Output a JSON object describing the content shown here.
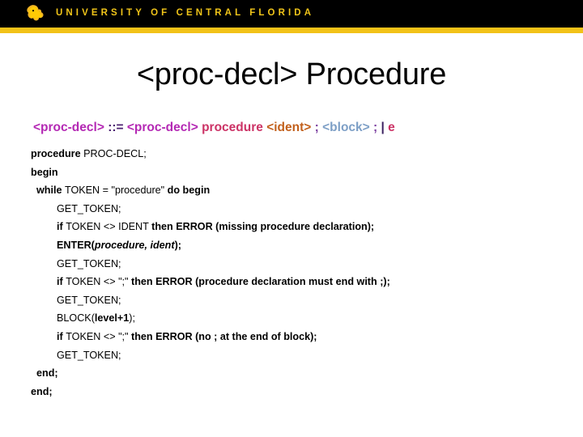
{
  "header": {
    "logo_icon": "ucf-pegasus-icon",
    "wordmark": "UNIVERSITY OF CENTRAL FLORIDA",
    "bar_color": "#000000",
    "rule_color": "#F2C218",
    "wordmark_color": "#F0C419"
  },
  "slide": {
    "title": "<proc-decl> Procedure"
  },
  "grammar": {
    "full_text": "<proc-decl> ::= <proc-decl> procedure <ident> ; <block> ; | e",
    "tokens": [
      {
        "text": "<proc-decl>",
        "role": "nonterminal-proc-decl",
        "color": "#B429B4"
      },
      {
        "text": " ",
        "role": "space",
        "color": "#000000"
      },
      {
        "text": "::=",
        "role": "defines-operator",
        "color": "#4B2070"
      },
      {
        "text": " ",
        "role": "space",
        "color": "#000000"
      },
      {
        "text": "<proc-decl>",
        "role": "nonterminal-proc-decl",
        "color": "#B429B4"
      },
      {
        "text": " ",
        "role": "space",
        "color": "#000000"
      },
      {
        "text": "procedure",
        "role": "terminal-keyword",
        "color": "#CC3366"
      },
      {
        "text": " ",
        "role": "space",
        "color": "#000000"
      },
      {
        "text": "<ident>",
        "role": "nonterminal-ident",
        "color": "#C2601C"
      },
      {
        "text": " ",
        "role": "space",
        "color": "#000000"
      },
      {
        "text": ";",
        "role": "terminal-semicolon",
        "color": "#7B3FA0"
      },
      {
        "text": " ",
        "role": "space",
        "color": "#000000"
      },
      {
        "text": "<block>",
        "role": "nonterminal-block",
        "color": "#7D9FC6"
      },
      {
        "text": " ",
        "role": "space",
        "color": "#000000"
      },
      {
        "text": ";",
        "role": "terminal-semicolon",
        "color": "#7B3FA0"
      },
      {
        "text": " ",
        "role": "space",
        "color": "#000000"
      },
      {
        "text": "|",
        "role": "alternation-bar",
        "color": "#3A2060"
      },
      {
        "text": " ",
        "role": "space",
        "color": "#000000"
      },
      {
        "text": "e",
        "role": "epsilon",
        "color": "#CC3366"
      }
    ]
  },
  "pseudocode": {
    "lines": [
      {
        "indent": 0,
        "runs": [
          {
            "t": "procedure ",
            "s": "b"
          },
          {
            "t": "PROC-DECL;",
            "s": ""
          }
        ]
      },
      {
        "indent": 0,
        "runs": [
          {
            "t": "begin",
            "s": "b"
          }
        ]
      },
      {
        "indent": 1,
        "runs": [
          {
            "t": "while ",
            "s": "b"
          },
          {
            "t": "TOKEN = \"procedure\" ",
            "s": ""
          },
          {
            "t": "do begin",
            "s": "b"
          }
        ]
      },
      {
        "indent": 2,
        "runs": [
          {
            "t": "GET_TOKEN;",
            "s": ""
          }
        ]
      },
      {
        "indent": 2,
        "runs": [
          {
            "t": "if ",
            "s": "b"
          },
          {
            "t": "TOKEN <> IDENT ",
            "s": ""
          },
          {
            "t": "then ERROR (missing procedure declaration);",
            "s": "b"
          }
        ]
      },
      {
        "indent": 2,
        "runs": [
          {
            "t": "ENTER(",
            "s": "b"
          },
          {
            "t": "procedure, ident",
            "s": "bi"
          },
          {
            "t": ");",
            "s": "b"
          }
        ]
      },
      {
        "indent": 2,
        "runs": [
          {
            "t": "GET_TOKEN;",
            "s": ""
          }
        ]
      },
      {
        "indent": 2,
        "runs": [
          {
            "t": "if ",
            "s": "b"
          },
          {
            "t": "TOKEN <> \";\" ",
            "s": ""
          },
          {
            "t": "then ERROR (procedure declaration must end with ;);",
            "s": "b"
          }
        ]
      },
      {
        "indent": 2,
        "runs": [
          {
            "t": "GET_TOKEN;",
            "s": ""
          }
        ]
      },
      {
        "indent": 2,
        "runs": [
          {
            "t": "BLOCK(",
            "s": ""
          },
          {
            "t": "level+1",
            "s": "b"
          },
          {
            "t": ");",
            "s": ""
          }
        ]
      },
      {
        "indent": 2,
        "runs": [
          {
            "t": "if ",
            "s": "b"
          },
          {
            "t": "TOKEN <> \";\" ",
            "s": ""
          },
          {
            "t": "then ERROR (no ; at the end of block);",
            "s": "b"
          }
        ]
      },
      {
        "indent": 2,
        "runs": [
          {
            "t": "GET_TOKEN;",
            "s": ""
          }
        ]
      },
      {
        "indent": 1,
        "runs": [
          {
            "t": "end;",
            "s": "b"
          }
        ]
      },
      {
        "indent": 0,
        "runs": [
          {
            "t": "end;",
            "s": "b"
          }
        ]
      }
    ]
  }
}
